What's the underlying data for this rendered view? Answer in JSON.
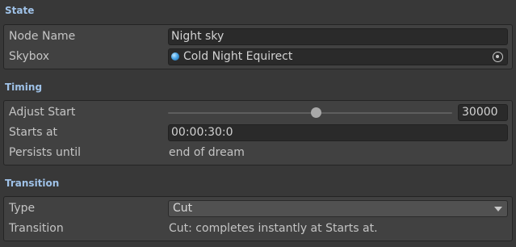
{
  "state": {
    "header": "State",
    "node_name_label": "Node Name",
    "node_name_value": "Night sky",
    "skybox_label": "Skybox",
    "skybox_value": "Cold Night Equirect",
    "skybox_icon": "material-sphere-icon",
    "skybox_picker_icon": "object-picker-icon"
  },
  "timing": {
    "header": "Timing",
    "adjust_start_label": "Adjust Start",
    "adjust_start_value": "30000",
    "adjust_start_fraction": 0.52,
    "starts_at_label": "Starts at",
    "starts_at_value": "00:00:30:0",
    "persists_until_label": "Persists until",
    "persists_until_value": "end of dream"
  },
  "transition": {
    "header": "Transition",
    "type_label": "Type",
    "type_value": "Cut",
    "type_caret_icon": "chevron-down-icon",
    "transition_label": "Transition",
    "transition_value": "Cut: completes instantly at Starts at."
  },
  "colors": {
    "header_text": "#9fc2e8",
    "panel_bg": "#383838",
    "group_bg": "#414141",
    "field_bg": "#2a2a2a",
    "dropdown_bg": "#515151"
  }
}
